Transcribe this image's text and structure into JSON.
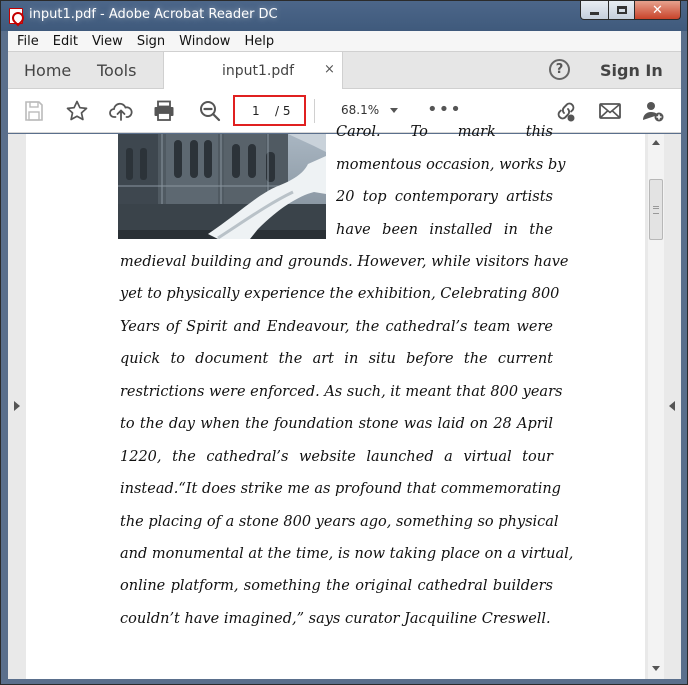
{
  "window": {
    "title": "input1.pdf - Adobe Acrobat Reader DC",
    "min_icon": "minimize-icon",
    "max_icon": "maximize-icon",
    "close_glyph": "✕"
  },
  "menu": [
    "File",
    "Edit",
    "View",
    "Sign",
    "Window",
    "Help"
  ],
  "tabs": {
    "home": "Home",
    "tools": "Tools",
    "document": "input1.pdf",
    "close_glyph": "×",
    "help_glyph": "?",
    "sign_in": "Sign In"
  },
  "toolbar": {
    "page_current": "1",
    "page_total": "/ 5",
    "zoom": "68.1%",
    "more": "•••",
    "icons": [
      "save-icon",
      "bookmark-star-icon",
      "upload-cloud-icon",
      "print-icon",
      "zoom-out-icon",
      "share-link-icon",
      "email-icon",
      "add-person-icon"
    ]
  },
  "document": {
    "wrap_lines": [
      "Carol. To mark this",
      "momentous occasion, works by",
      "20 top contemporary artists",
      "have been installed in the"
    ],
    "lines": [
      "medieval building and grounds. However, while visitors have",
      "yet to physically experience the exhibition, Celebrating 800",
      "Years of Spirit and Endeavour, the cathedral’s team were",
      "quick to document the art in situ before the current",
      "restrictions were enforced. As such, it meant that 800 years",
      "to the day when the foundation stone was laid on 28 April",
      "1220, the cathedral’s website launched a virtual tour",
      "instead.“It does strike me as profound that commemorating",
      "the placing of a stone 800 years ago, something so physical",
      "and monumental at the time, is now taking place on a virtual,",
      "online platform, something the original cathedral builders",
      "couldn’t have imagined,” says curator Jacquiline Creswell."
    ]
  }
}
